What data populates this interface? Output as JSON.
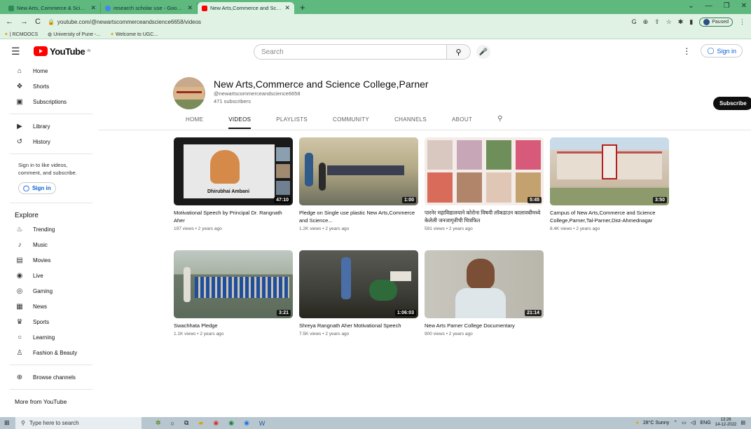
{
  "browser": {
    "tabs": [
      {
        "title": "New Arts, Commerce & Science",
        "color": "#2e8b57",
        "active": false
      },
      {
        "title": "research scholar use - Google Se",
        "color": "#4285f4",
        "active": false
      },
      {
        "title": "New Arts,Commerce and Science",
        "color": "#ff0000",
        "active": true
      }
    ],
    "new_tab": "+",
    "url": "youtube.com/@newartscommerceandscience6658/videos",
    "paused_label": "Paused",
    "bookmarks": [
      "| RCMOOCS",
      "University of Pune -...",
      "Welcome to UGC..."
    ]
  },
  "youtube": {
    "logo_text": "YouTube",
    "logo_region": "IN",
    "search_placeholder": "Search",
    "sign_in": "Sign in"
  },
  "sidebar": {
    "main": [
      {
        "label": "Home",
        "icon": "⌂"
      },
      {
        "label": "Shorts",
        "icon": "❖"
      },
      {
        "label": "Subscriptions",
        "icon": "▣"
      }
    ],
    "library": [
      {
        "label": "Library",
        "icon": "▶"
      },
      {
        "label": "History",
        "icon": "↺"
      }
    ],
    "sign_in_hint": "Sign in to like videos, comment, and subscribe.",
    "sign_in_label": "Sign in",
    "explore_title": "Explore",
    "explore": [
      {
        "label": "Trending",
        "icon": "♨"
      },
      {
        "label": "Music",
        "icon": "♪"
      },
      {
        "label": "Movies",
        "icon": "▤"
      },
      {
        "label": "Live",
        "icon": "◉"
      },
      {
        "label": "Gaming",
        "icon": "◎"
      },
      {
        "label": "News",
        "icon": "▦"
      },
      {
        "label": "Sports",
        "icon": "♛"
      },
      {
        "label": "Learning",
        "icon": "○"
      },
      {
        "label": "Fashion & Beauty",
        "icon": "♙"
      }
    ],
    "browse_channels": "Browse channels",
    "more_from": "More from YouTube"
  },
  "channel": {
    "name": "New Arts,Commerce and Science College,Parner",
    "handle": "@newartscommerceandscience6658",
    "subscribers": "471 subscribers",
    "subscribe_label": "Subscribe",
    "tabs": [
      "HOME",
      "VIDEOS",
      "PLAYLISTS",
      "COMMUNITY",
      "CHANNELS",
      "ABOUT"
    ],
    "active_tab": "VIDEOS"
  },
  "videos": [
    {
      "title": "Motivational Speech by Principal Dr. Rangnath Aher",
      "meta": "197 views • 2 years ago",
      "duration": "47:10",
      "thumb_caption": "Dhirubhai Ambani"
    },
    {
      "title": "Pledge on Single use plastic New Arts,Commerce and Science...",
      "meta": "1.2K views • 2 years ago",
      "duration": "1:00"
    },
    {
      "title": "पारनेर महाविद्यालयाने कोरोना विषयी लॉकडाउन कालावधीमध्ये केलेली जनजागृतीची चित्रफित",
      "meta": "591 views • 2 years ago",
      "duration": "5:45"
    },
    {
      "title": "Campus of New Arts,Commerce and Science College,Parner,Tal-Parner,Dist-Ahmednagar",
      "meta": "8.4K views • 2 years ago",
      "duration": "3:50"
    },
    {
      "title": "Swachhata Pledge",
      "meta": "1.1K views • 2 years ago",
      "duration": "3:21"
    },
    {
      "title": "Shreya Rangnath Aher Motivational Speech",
      "meta": "7.5K views • 2 years ago",
      "duration": "1:06:03"
    },
    {
      "title": "New Arts Parner College Documentary",
      "meta": "900 views • 2 years ago",
      "duration": "21:14"
    }
  ],
  "taskbar": {
    "search_placeholder": "Type here to search",
    "weather": "28°C  Sunny",
    "lang": "ENG",
    "time": "13:26",
    "date": "14-12-2022"
  }
}
